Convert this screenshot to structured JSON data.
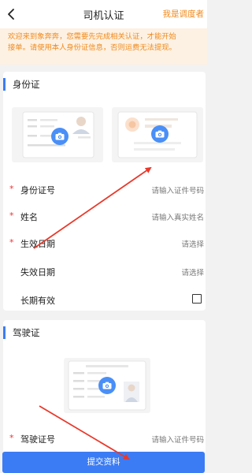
{
  "header": {
    "title": "司机认证",
    "dispatcher_link": "我是调度者"
  },
  "notice": {
    "line1": "欢迎来到象奔奔，您需要先完成相关认证，才能开始",
    "line2": "接单。请使用本人身份证信息，否则运费无法提现。"
  },
  "id_section": {
    "title": "身份证",
    "fields": [
      {
        "label": "身份证号",
        "required": true,
        "placeholder": "请输入证件号码"
      },
      {
        "label": "姓名",
        "required": true,
        "placeholder": "请输入真实姓名"
      },
      {
        "label": "生效日期",
        "required": true,
        "placeholder": "请选择"
      },
      {
        "label": "失效日期",
        "required": false,
        "placeholder": "请选择"
      },
      {
        "label": "长期有效",
        "required": false,
        "checked": false
      }
    ]
  },
  "license_section": {
    "title": "驾驶证",
    "fields": [
      {
        "label": "驾驶证号",
        "required": true,
        "placeholder": "请输入证件号码"
      }
    ]
  },
  "submit_label": "提交资料",
  "colors": {
    "accent": "#3b7cf5",
    "warning": "#f08a1c",
    "notice_bg": "#fdf1e3",
    "required": "#ee3333",
    "arrow": "#e8392b"
  }
}
